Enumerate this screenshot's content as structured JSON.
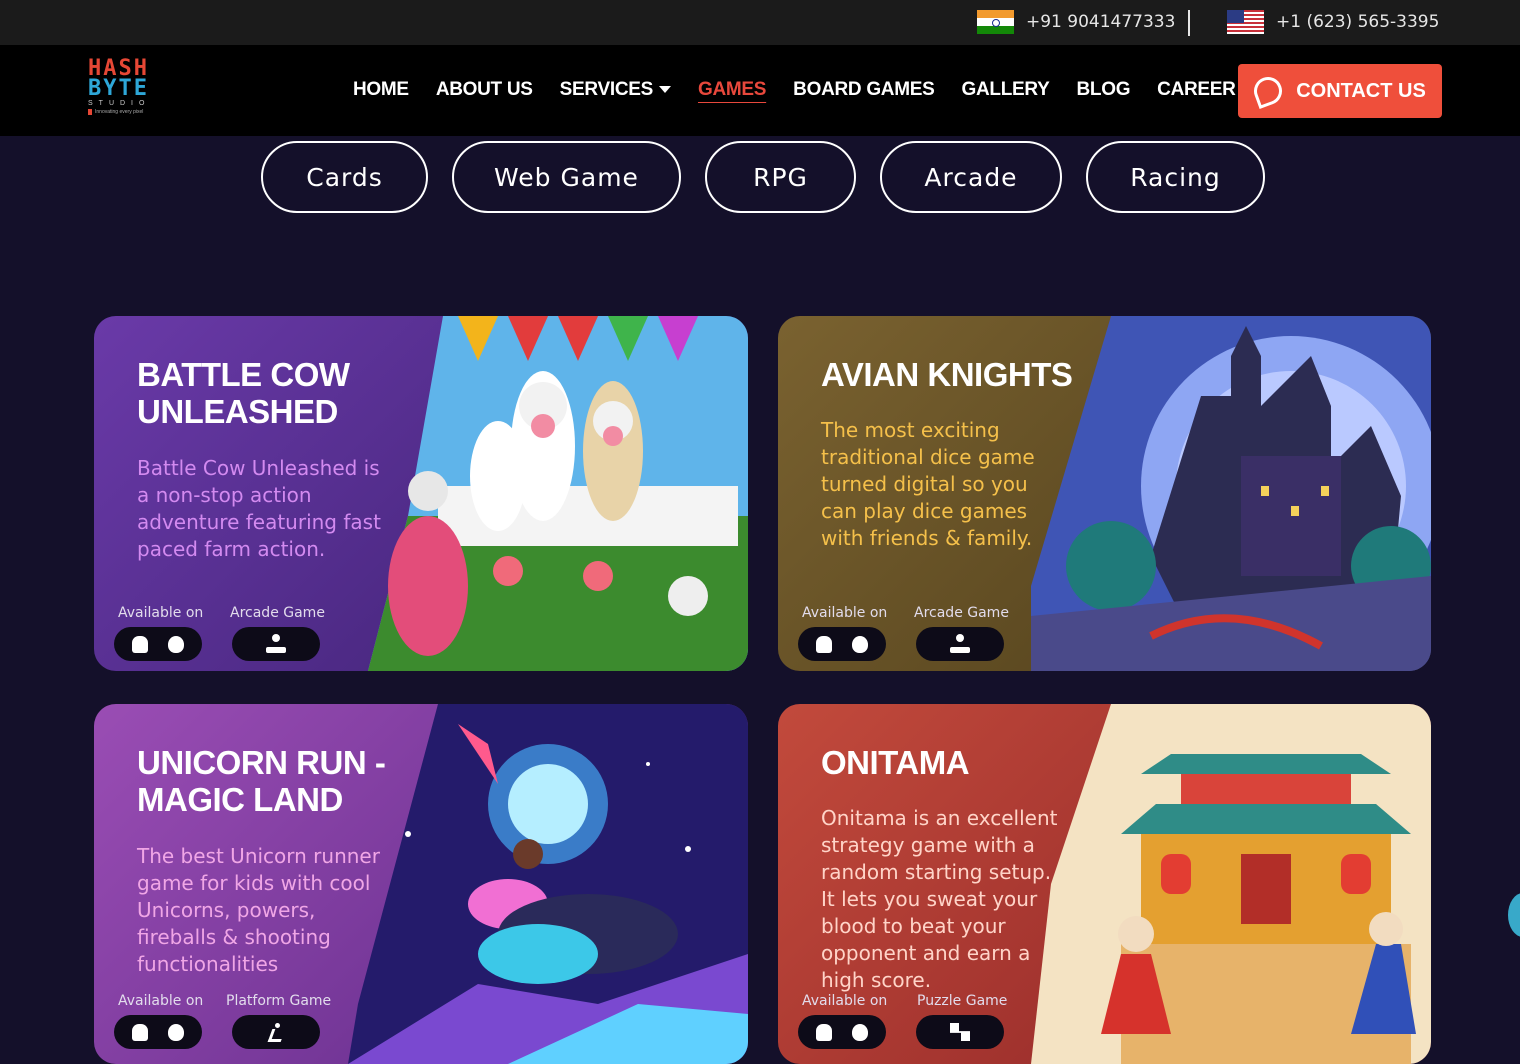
{
  "topbar": {
    "phone_india": "+91 9041477333",
    "phone_us": "+1 (623) 565-3395"
  },
  "nav": {
    "logo_line1": "HASH",
    "logo_line2": "BYTE",
    "logo_line3": "STUDIO",
    "logo_tagline": "Innovating every pixel",
    "items": [
      "HOME",
      "ABOUT US",
      "SERVICES",
      "GAMES",
      "BOARD GAMES",
      "GALLERY",
      "BLOG",
      "CAREER"
    ],
    "active": "GAMES",
    "contact_label": "CONTACT US"
  },
  "filters": [
    "Cards",
    "Web Game",
    "RPG",
    "Arcade",
    "Racing"
  ],
  "cards": [
    {
      "title": "BATTLE COW UNLEASHED",
      "description": "Battle Cow Unleashed is a non-stop action adventure featuring fast paced farm action.",
      "available_label": "Available on",
      "genre": "Arcade Game",
      "colors": {
        "panel": "#5a2f96",
        "text": "#d38af0"
      }
    },
    {
      "title": "AVIAN KNIGHTS",
      "description": "The most exciting traditional dice game turned digital so you can play dice games with friends & family.",
      "available_label": "Available on",
      "genre": "Arcade Game",
      "colors": {
        "panel": "#6b5424",
        "text": "#f5c04a"
      }
    },
    {
      "title": "UNICORN RUN - MAGIC LAND",
      "description": "The best Unicorn runner game for kids with cool Unicorns, powers, fireballs & shooting functionalities",
      "available_label": "Available on",
      "genre": "Platform Game",
      "colors": {
        "panel": "#8a3ea8",
        "text": "#f0a6e6"
      }
    },
    {
      "title": "ONITAMA",
      "description": "Onitama is an excellent strategy game with a random starting setup. It lets you sweat your blood to beat your opponent and earn a high score.",
      "available_label": "Available on",
      "genre": "Puzzle Game",
      "colors": {
        "panel": "#b23a35",
        "text": "#ffd4c8"
      }
    }
  ]
}
